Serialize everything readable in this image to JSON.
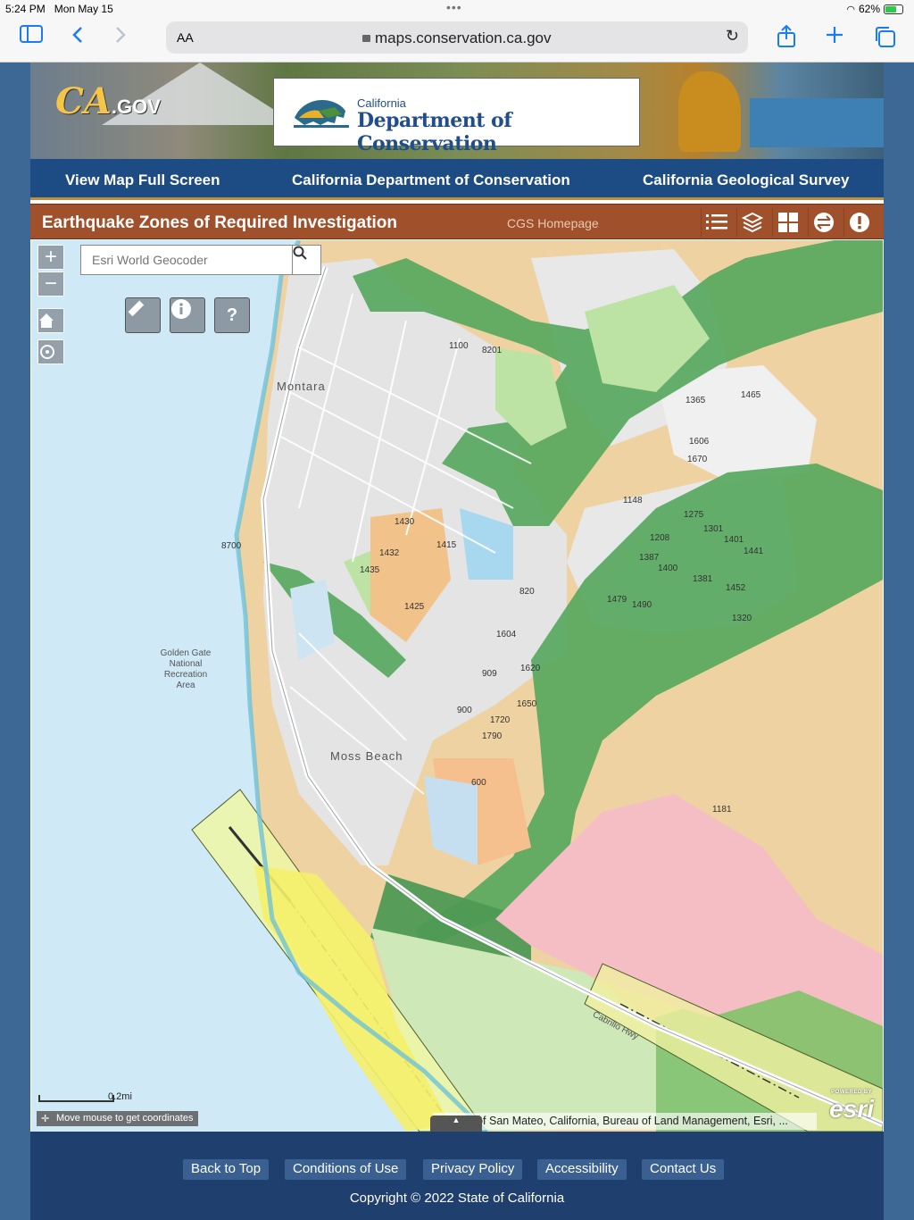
{
  "status_bar": {
    "time": "5:24 PM",
    "date": "Mon May 15",
    "battery": "62%"
  },
  "browser": {
    "text_size": "AA",
    "url": "maps.conservation.ca.gov"
  },
  "banner": {
    "cagov_logo": "CA",
    "cagov_suffix": ".GOV",
    "dept_small": "California",
    "dept_name": "Department of Conservation"
  },
  "nav": {
    "items": [
      "View Map Full Screen",
      "California Department of Conservation",
      "California Geological Survey"
    ]
  },
  "map_header": {
    "title": "Earthquake Zones of Required Investigation",
    "link": "CGS Homepage"
  },
  "map": {
    "zoom_in": "+",
    "zoom_out": "−",
    "search_placeholder": "Esri World Geocoder",
    "tools": {
      "help": "?"
    },
    "labels": {
      "montara": "Montara",
      "moss_beach": "Moss Beach",
      "golden_gate": "Golden Gate National Recreation Area",
      "cabrillo_hwy": "Cabrillo Hwy"
    },
    "scale_label": "0.2mi",
    "coordinates_hint": "Move mouse to get coordinates",
    "attribution": "County of San Mateo, California, Bureau of Land Management, Esri, ...",
    "esri_powered": "POWERED BY",
    "esri_logo": "esri",
    "lot_numbers": [
      "1100",
      "8201",
      "1430",
      "1432",
      "1415",
      "1435",
      "1425",
      "8700",
      "1604",
      "820",
      "909",
      "900",
      "1620",
      "1650",
      "1720",
      "1790",
      "1365",
      "1465",
      "1606",
      "1670",
      "1208",
      "1301",
      "1401",
      "1441",
      "1387",
      "1381",
      "1452",
      "1400",
      "1320",
      "1479",
      "1490",
      "1181",
      "600",
      "1148",
      "1275"
    ]
  },
  "footer": {
    "links": [
      "Back to Top",
      "Conditions of Use",
      "Privacy Policy",
      "Accessibility",
      "Contact Us"
    ],
    "copyright": "Copyright © 2022 State of California"
  },
  "colors": {
    "nav_blue": "#1d4c84",
    "header_brown": "#a0502a",
    "footer_blue": "#1f3f6e",
    "ios_blue": "#1a7cf5"
  }
}
